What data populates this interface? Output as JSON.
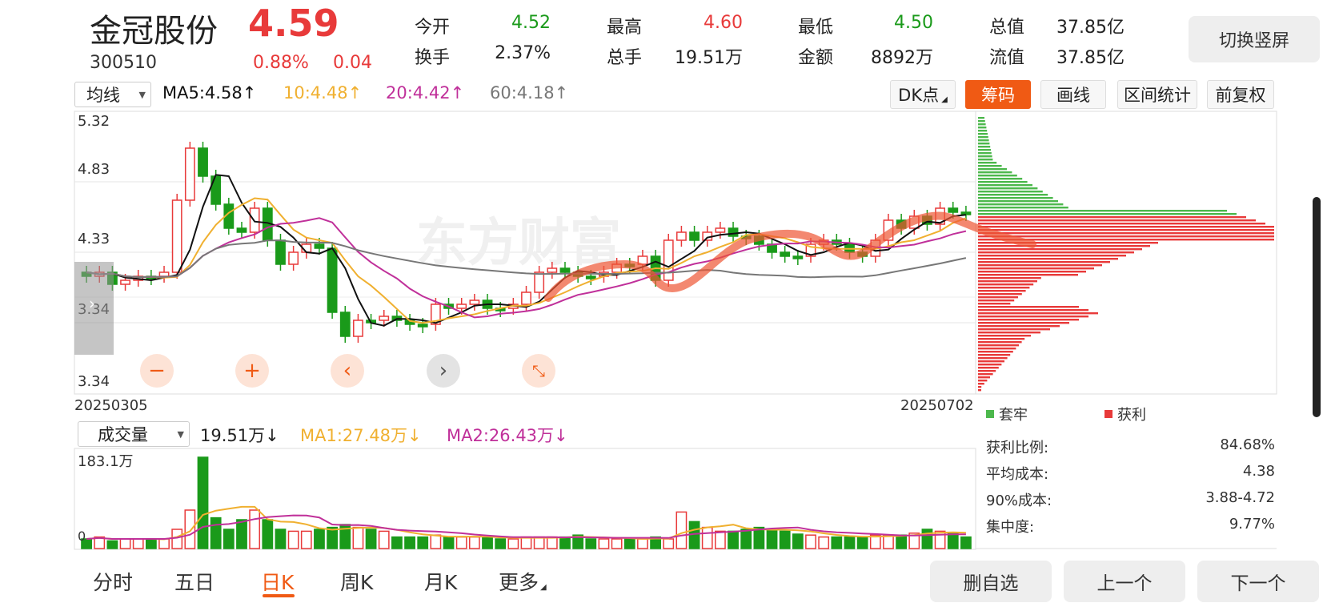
{
  "header": {
    "name": "金冠股份",
    "price": "4.59",
    "code": "300510",
    "change_pct": "0.88%",
    "change_amt": "0.04",
    "quotes": [
      {
        "label": "今开",
        "value": "4.52",
        "color": "green"
      },
      {
        "label": "最高",
        "value": "4.60",
        "color": "red"
      },
      {
        "label": "最低",
        "value": "4.50",
        "color": "green"
      },
      {
        "label": "总值",
        "value": "37.85亿",
        "color": "black"
      },
      {
        "label": "换手",
        "value": "2.37%",
        "color": "black"
      },
      {
        "label": "总手",
        "value": "19.51万",
        "color": "black"
      },
      {
        "label": "金额",
        "value": "8892万",
        "color": "black"
      },
      {
        "label": "流值",
        "value": "37.85亿",
        "color": "black"
      }
    ],
    "switch_label": "切换竖屏"
  },
  "toolbar": {
    "indicator": "均线",
    "ma5": "MA5:4.58",
    "ma10": "10:4.48",
    "ma20": "20:4.42",
    "ma60": "60:4.18",
    "arrow": "↑",
    "buttons": [
      "DK点",
      "筹码",
      "画线",
      "区间统计",
      "前复权"
    ],
    "active_button": "筹码"
  },
  "colors": {
    "up": "#e83a3a",
    "down": "#1a9a1a",
    "ma5": "#111111",
    "ma10": "#f0b030",
    "ma20": "#c0309a",
    "ma60": "#777777",
    "accent": "#f05a14"
  },
  "price_axis": [
    "5.32",
    "4.83",
    "4.33",
    "3.34",
    "3.34"
  ],
  "dates": {
    "start": "20250305",
    "end": "20250702"
  },
  "chips_legend": {
    "loss": "套牢",
    "profit": "获利"
  },
  "chip_stats": [
    {
      "label": "获利比例:",
      "value": "84.68%"
    },
    {
      "label": "平均成本:",
      "value": "4.38"
    },
    {
      "label": "90%成本:",
      "value": "3.88-4.72"
    },
    {
      "label": "集中度:",
      "value": "9.77%"
    }
  ],
  "volume": {
    "indicator": "成交量",
    "value": "19.51万",
    "ma1": "MA1:27.48万",
    "ma2": "MA2:26.43万",
    "arrow": "↓",
    "axis_top": "183.1万",
    "axis_zero": "0"
  },
  "controls": [
    "minus-icon",
    "plus-icon",
    "left-icon",
    "right-icon",
    "shrink-icon"
  ],
  "tabs": [
    "分时",
    "五日",
    "日K",
    "周K",
    "月K",
    "更多"
  ],
  "active_tab": "日K",
  "bottom_buttons": [
    "删自选",
    "上一个",
    "下一个"
  ],
  "watermark": "东方财富"
}
